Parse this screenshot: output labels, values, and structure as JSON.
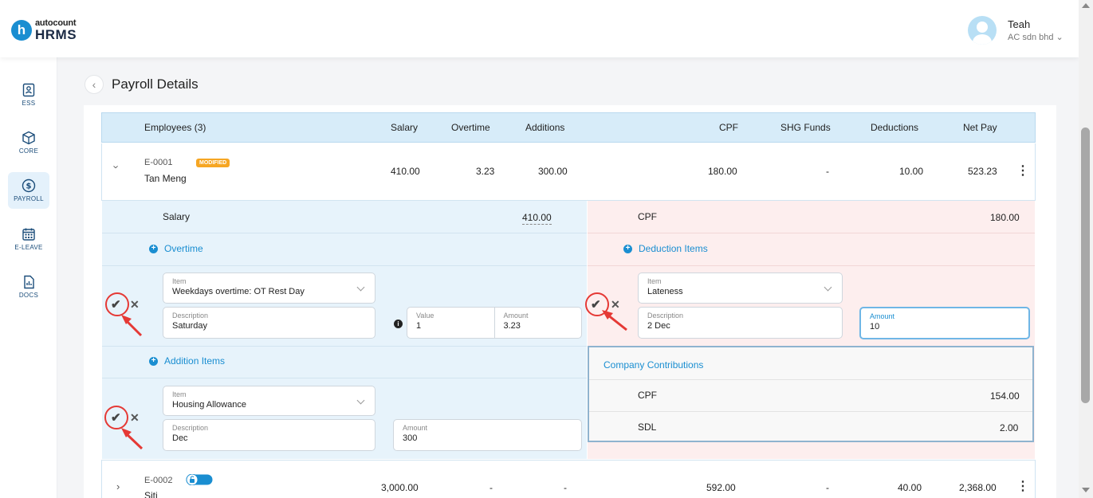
{
  "header": {
    "logo_small": "autocount",
    "logo_big": "HRMS",
    "logo_letter": "h",
    "user_name": "Teah",
    "company": "AC sdn bhd ⌄"
  },
  "sidebar": {
    "items": [
      {
        "label": "ESS",
        "icon": "ess-icon"
      },
      {
        "label": "CORE",
        "icon": "cube-icon"
      },
      {
        "label": "PAYROLL",
        "icon": "dollar-icon",
        "active": true
      },
      {
        "label": "E-LEAVE",
        "icon": "calendar-icon"
      },
      {
        "label": "DOCS",
        "icon": "document-icon"
      }
    ]
  },
  "page": {
    "title": "Payroll Details",
    "back": "‹"
  },
  "table": {
    "columns": [
      "Employees (3)",
      "Salary",
      "Overtime",
      "Additions",
      "CPF",
      "SHG Funds",
      "Deductions",
      "Net Pay"
    ],
    "rows": [
      {
        "id": "E-0001",
        "badge": "MODIFIED",
        "name": "Tan Meng",
        "salary": "410.00",
        "overtime": "3.23",
        "additions": "300.00",
        "cpf": "180.00",
        "shg": "-",
        "deductions": "10.00",
        "net_pay": "523.23"
      },
      {
        "id": "E-0002",
        "name": "Siti",
        "salary": "3,000.00",
        "overtime": "-",
        "additions": "-",
        "cpf": "592.00",
        "shg": "-",
        "deductions": "40.00",
        "net_pay": "2,368.00"
      }
    ]
  },
  "detail": {
    "salary_label": "Salary",
    "salary_value": "410.00",
    "cpf_label": "CPF",
    "cpf_value": "180.00",
    "overtime_link": "Overtime",
    "deduction_link": "Deduction Items",
    "addition_link": "Addition Items",
    "overtime_item": {
      "item_label": "Item",
      "item_value": "Weekdays overtime: OT Rest Day",
      "desc_label": "Description",
      "desc_value": "Saturday",
      "value_label": "Value",
      "value_value": "1",
      "amount_label": "Amount",
      "amount_value": "3.23"
    },
    "deduction_item": {
      "item_label": "Item",
      "item_value": "Lateness",
      "desc_label": "Description",
      "desc_value": "2 Dec",
      "amount_label": "Amount",
      "amount_value": "10"
    },
    "addition_item": {
      "item_label": "Item",
      "item_value": "Housing Allowance",
      "desc_label": "Description",
      "desc_value": "Dec",
      "amount_label": "Amount",
      "amount_value": "300"
    },
    "contributions": {
      "title": "Company Contributions",
      "rows": [
        {
          "label": "CPF",
          "value": "154.00"
        },
        {
          "label": "SDL",
          "value": "2.00"
        }
      ]
    }
  },
  "icons": {
    "check": "✔",
    "close": "✕",
    "kebab": "⋮",
    "chevron_down": "⌄",
    "chevron_right": "›",
    "info": "i",
    "plus": "+"
  },
  "colors": {
    "accent": "#1a8ed1",
    "header_bg": "#d7ecf9",
    "left_panel": "#e7f3fb",
    "right_panel": "#fdeeee",
    "badge": "#f6a623",
    "annotation": "#e53935"
  }
}
